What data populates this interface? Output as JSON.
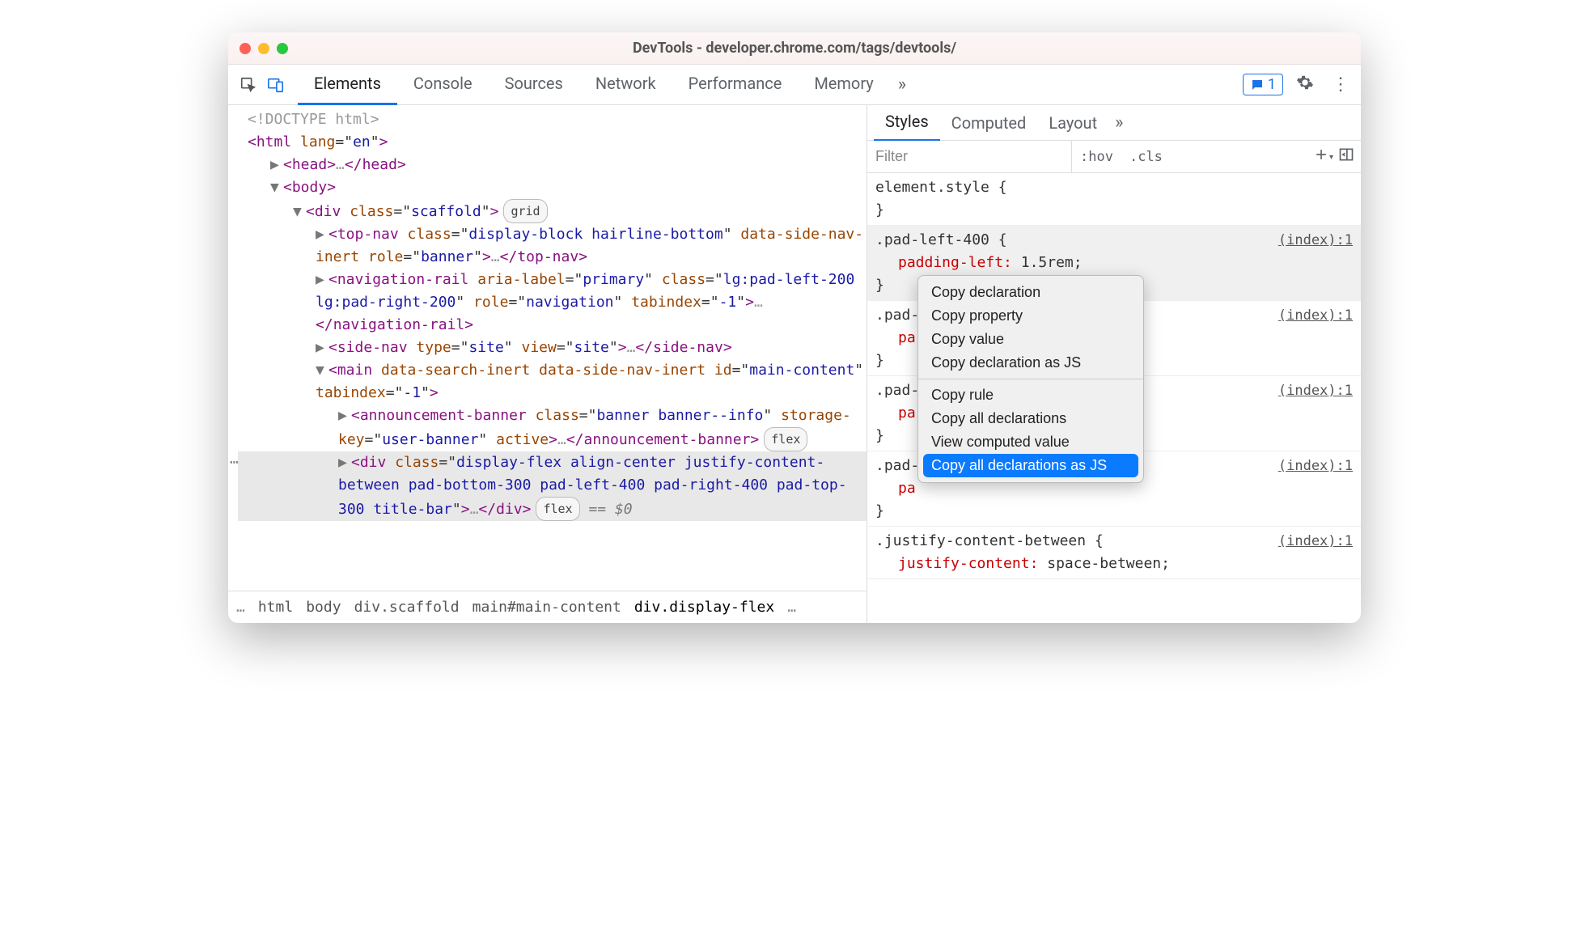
{
  "window": {
    "title": "DevTools - developer.chrome.com/tags/devtools/"
  },
  "toolbar": {
    "tabs": [
      "Elements",
      "Console",
      "Sources",
      "Network",
      "Performance",
      "Memory"
    ],
    "active_tab": "Elements",
    "issues_count": "1"
  },
  "dom_lines": [
    {
      "indent": 0,
      "html": "<span class='doctype'>&lt;!DOCTYPE html&gt;</span>"
    },
    {
      "indent": 0,
      "html": "<span class='punct'>&lt;</span><span class='tag'>html</span> <span class='attr'>lang</span>=\"<span class='val'>en</span>\"<span class='punct'>&gt;</span>"
    },
    {
      "indent": 1,
      "arrow": "▶",
      "html": "<span class='punct'>&lt;</span><span class='tag'>head</span><span class='punct'>&gt;</span><span class='gray'>…</span><span class='punct'>&lt;/</span><span class='tag'>head</span><span class='punct'>&gt;</span>"
    },
    {
      "indent": 1,
      "arrow": "▼",
      "html": "<span class='punct'>&lt;</span><span class='tag'>body</span><span class='punct'>&gt;</span>"
    },
    {
      "indent": 2,
      "arrow": "▼",
      "html": "<span class='punct'>&lt;</span><span class='tag'>div</span> <span class='attr'>class</span>=\"<span class='val'>scaffold</span>\"<span class='punct'>&gt;</span><span class='badge'>grid</span>"
    },
    {
      "indent": 3,
      "arrow": "▶",
      "html": "<span class='punct'>&lt;</span><span class='tag'>top-nav</span> <span class='attr'>class</span>=\"<span class='val'>display-block hairline-bottom</span>\" <span class='attr'>data-side-nav-inert</span> <span class='attr'>role</span>=\"<span class='val'>banner</span>\"<span class='punct'>&gt;</span><span class='gray'>…</span><span class='punct'>&lt;/</span><span class='tag'>top-nav</span><span class='punct'>&gt;</span>"
    },
    {
      "indent": 3,
      "arrow": "▶",
      "html": "<span class='punct'>&lt;</span><span class='tag'>navigation-rail</span> <span class='attr'>aria-label</span>=\"<span class='val'>primary</span>\" <span class='attr'>class</span>=\"<span class='val'>lg:pad-left-200 lg:pad-right-200</span>\" <span class='attr'>role</span>=\"<span class='val'>navigation</span>\" <span class='attr'>tabindex</span>=\"<span class='val'>-1</span>\"<span class='punct'>&gt;</span><span class='gray'>…</span><span class='punct'>&lt;/</span><span class='tag'>navigation-rail</span><span class='punct'>&gt;</span>"
    },
    {
      "indent": 3,
      "arrow": "▶",
      "html": "<span class='punct'>&lt;</span><span class='tag'>side-nav</span> <span class='attr'>type</span>=\"<span class='val'>site</span>\" <span class='attr'>view</span>=\"<span class='val'>site</span>\"<span class='punct'>&gt;</span><span class='gray'>…</span><span class='punct'>&lt;/</span><span class='tag'>side-nav</span><span class='punct'>&gt;</span>"
    },
    {
      "indent": 3,
      "arrow": "▼",
      "html": "<span class='punct'>&lt;</span><span class='tag'>main</span> <span class='attr'>data-search-inert</span> <span class='attr'>data-side-nav-inert</span> <span class='attr'>id</span>=\"<span class='val'>main-content</span>\" <span class='attr'>tabindex</span>=\"<span class='val'>-1</span>\"<span class='punct'>&gt;</span>"
    },
    {
      "indent": 4,
      "arrow": "▶",
      "html": "<span class='punct'>&lt;</span><span class='tag'>announcement-banner</span> <span class='attr'>class</span>=\"<span class='val'>banner banner--info</span>\" <span class='attr'>storage-key</span>=\"<span class='val'>user-banner</span>\" <span class='attr'>active</span><span class='punct'>&gt;</span><span class='gray'>…</span><span class='punct'>&lt;/</span><span class='tag'>announcement-banner</span><span class='punct'>&gt;</span><span class='badge'>flex</span>"
    },
    {
      "indent": 4,
      "arrow": "▶",
      "selected": true,
      "ellip": true,
      "html": "<span class='punct'>&lt;</span><span class='tag'>div</span> <span class='attr'>class</span>=\"<span class='val'>display-flex align-center justify-content-between pad-bottom-300 pad-left-400 pad-right-400 pad-top-300 title-bar</span>\"<span class='punct'>&gt;</span><span class='gray'>…</span><span class='punct'>&lt;/</span><span class='tag'>div</span><span class='punct'>&gt;</span><span class='badge'>flex</span> <span class='dollar'>== $0</span>"
    }
  ],
  "breadcrumbs": [
    "html",
    "body",
    "div.scaffold",
    "main#main-content",
    "div.display-flex"
  ],
  "styles": {
    "tabs": [
      "Styles",
      "Computed",
      "Layout"
    ],
    "active_tab": "Styles",
    "filter_placeholder": "Filter",
    "hov": ":hov",
    "cls": ".cls",
    "rules": [
      {
        "selector": "element.style {",
        "src": "",
        "props": [],
        "close": "}"
      },
      {
        "selector": ".pad-left-400 {",
        "src": "(index):1",
        "hl": true,
        "props": [
          {
            "name": "padding-left",
            "value": "1.5rem;"
          }
        ],
        "close": "}"
      },
      {
        "selector": ".pad-",
        "src": "(index):1",
        "props": [
          {
            "name": "pa",
            "value": ""
          }
        ],
        "close": "}"
      },
      {
        "selector": ".pad-",
        "src": "(index):1",
        "props": [
          {
            "name": "pa",
            "value": ""
          }
        ],
        "close": "}"
      },
      {
        "selector": ".pad-",
        "src": "(index):1",
        "props": [
          {
            "name": "pa",
            "value": ""
          }
        ],
        "close": "}"
      },
      {
        "selector": ".justify-content-between {",
        "src": "(index):1",
        "props": [
          {
            "name": "justify-content",
            "value": "space-between;"
          }
        ],
        "close": ""
      }
    ]
  },
  "context_menu": {
    "items": [
      "Copy declaration",
      "Copy property",
      "Copy value",
      "Copy declaration as JS",
      "---",
      "Copy rule",
      "Copy all declarations",
      "View computed value",
      "Copy all declarations as JS"
    ],
    "selected": "Copy all declarations as JS"
  }
}
